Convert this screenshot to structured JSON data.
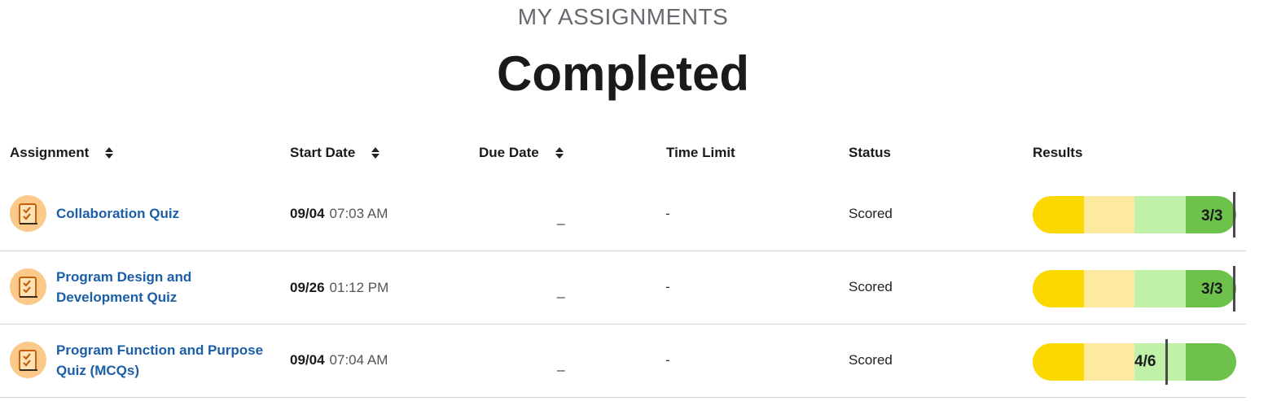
{
  "header": {
    "eyebrow": "MY ASSIGNMENTS",
    "title": "Completed"
  },
  "columns": {
    "assignment": "Assignment",
    "start_date": "Start Date",
    "due_date": "Due Date",
    "time_limit": "Time Limit",
    "status": "Status",
    "results": "Results"
  },
  "rows": [
    {
      "name": "Collaboration Quiz",
      "start_day": "09/04",
      "start_time": "07:03 AM",
      "due": "_",
      "time_limit": "-",
      "status": "Scored",
      "score": "3/3",
      "score_fraction": 1.0
    },
    {
      "name": "Program Design and Development Quiz",
      "start_day": "09/26",
      "start_time": "01:12 PM",
      "due": "_",
      "time_limit": "-",
      "status": "Scored",
      "score": "3/3",
      "score_fraction": 1.0
    },
    {
      "name": "Program Function and Purpose Quiz (MCQs)",
      "start_day": "09/04",
      "start_time": "07:04 AM",
      "due": "_",
      "time_limit": "-",
      "status": "Scored",
      "score": "4/6",
      "score_fraction": 0.667
    }
  ],
  "icon": "quiz-checklist-icon",
  "colors": {
    "link": "#1b5ea8",
    "icon_bg": "#fbc98a",
    "result_segments": [
      "#fbd800",
      "#fde9a0",
      "#bff1a8",
      "#6cc24a"
    ]
  }
}
